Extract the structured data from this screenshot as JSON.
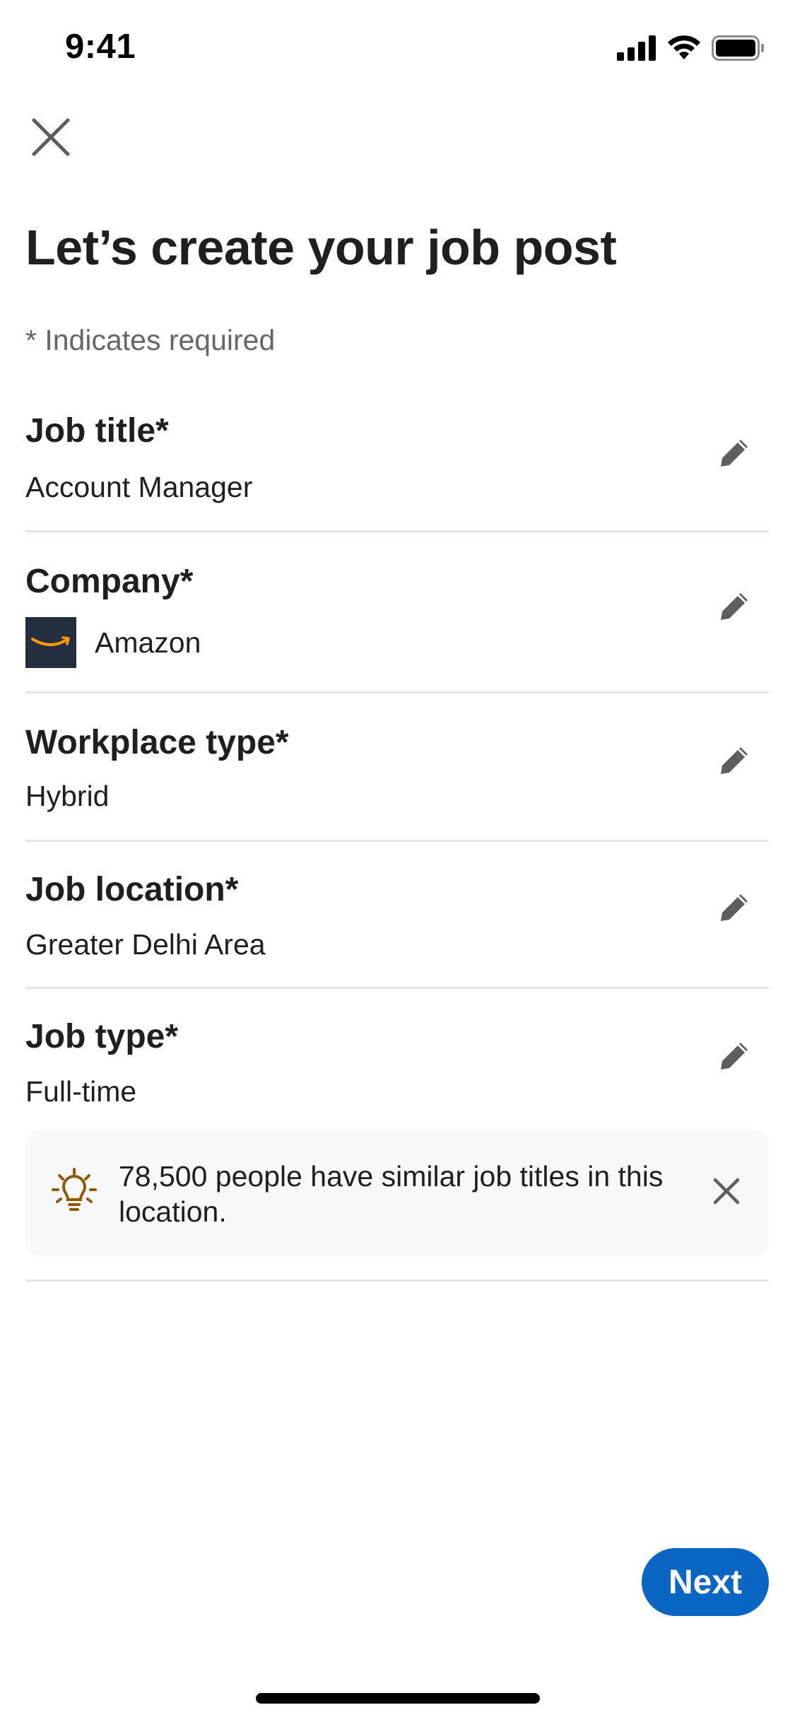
{
  "status_bar": {
    "time": "9:41",
    "icons": [
      "cellular-signal-icon",
      "wifi-icon",
      "battery-icon"
    ]
  },
  "header": {
    "close_icon": "close-icon",
    "title": "Let’s create your job post",
    "required_note": "* Indicates required"
  },
  "fields": {
    "job_title": {
      "label": "Job title*",
      "value": "Account Manager"
    },
    "company": {
      "label": "Company*",
      "value": "Amazon",
      "logo_bg": "#232f3e",
      "logo_smile": "#ff9900"
    },
    "workplace_type": {
      "label": "Workplace type*",
      "value": "Hybrid"
    },
    "job_location": {
      "label": "Job location*",
      "value": "Greater Delhi Area"
    },
    "job_type": {
      "label": "Job type*",
      "value": "Full-time"
    }
  },
  "insight": {
    "icon": "lightbulb-icon",
    "text": "78,500 people have similar job titles in this location."
  },
  "footer": {
    "next_label": "Next"
  },
  "colors": {
    "primary": "#0a66c2",
    "text": "#1f1f1f",
    "muted": "#666666",
    "divider": "#e6e6e6",
    "insight_bg": "#f7f8fa",
    "lightbulb": "#915907"
  }
}
